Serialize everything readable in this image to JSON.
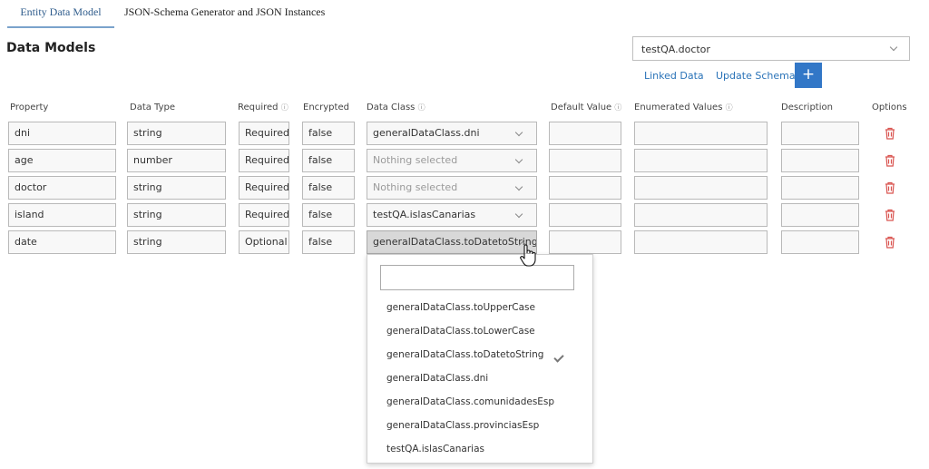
{
  "tabs": [
    {
      "label": "Entity Data Model"
    },
    {
      "label": "JSON-Schema Generator and JSON Instances"
    }
  ],
  "page_title": "Data Models",
  "model_select": {
    "value": "testQA.doctor"
  },
  "actions": {
    "linked_data": "Linked Data",
    "update_schema": "Update Schema",
    "add_icon": "+"
  },
  "columns": {
    "property": "Property",
    "data_type": "Data Type",
    "required": "Required",
    "encrypted": "Encrypted",
    "data_class": "Data Class",
    "default_value": "Default Value",
    "enumerated_values": "Enumerated Values",
    "description": "Description",
    "options": "Options",
    "info_icon": "ⓘ"
  },
  "rows": [
    {
      "property": "dni",
      "data_type": "string",
      "required": "Required",
      "encrypted": "false",
      "data_class": "generalDataClass.dni"
    },
    {
      "property": "age",
      "data_type": "number",
      "required": "Required",
      "encrypted": "false",
      "data_class": "Nothing selected"
    },
    {
      "property": "doctor",
      "data_type": "string",
      "required": "Required",
      "encrypted": "false",
      "data_class": "Nothing selected"
    },
    {
      "property": "island",
      "data_type": "string",
      "required": "Required",
      "encrypted": "false",
      "data_class": "testQA.islasCanarias"
    },
    {
      "property": "date",
      "data_type": "string",
      "required": "Optional",
      "encrypted": "false",
      "data_class": "generalDataClass.toDatetoString"
    }
  ],
  "dropdown": {
    "selected": "generalDataClass.toDatetoString",
    "options": [
      "generalDataClass.toUpperCase",
      "generalDataClass.toLowerCase",
      "generalDataClass.toDatetoString",
      "generalDataClass.dni",
      "generalDataClass.comunidadesEsp",
      "generalDataClass.provinciasEsp",
      "testQA.islasCanarias"
    ]
  },
  "colors": {
    "accent": "#3277c7",
    "link": "#2a73b8",
    "danger": "#d9534f",
    "active_tab_underline": "#7aa3cc"
  },
  "icons": {
    "delete": "trash-icon",
    "dropdown": "chevron-down-icon",
    "check": "check-icon",
    "cursor": "hand-pointer-icon"
  }
}
